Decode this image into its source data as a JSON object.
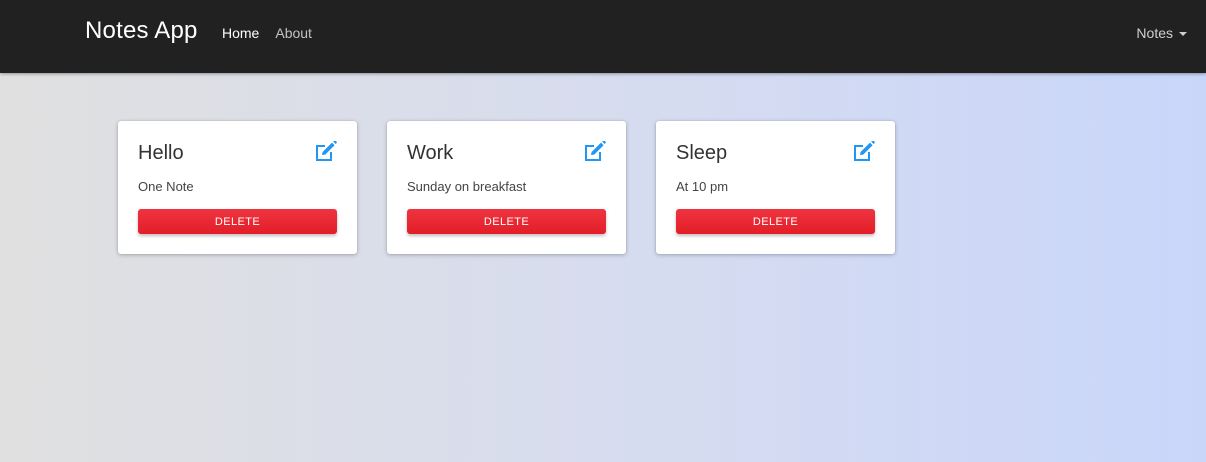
{
  "navbar": {
    "brand": "Notes App",
    "links": [
      {
        "label": "Home",
        "active": true
      },
      {
        "label": "About",
        "active": false
      }
    ],
    "dropdown_label": "Notes"
  },
  "notes": [
    {
      "title": "Hello",
      "text": "One Note",
      "delete_label": "DELETE",
      "edit_icon": "edit-icon"
    },
    {
      "title": "Work",
      "text": "Sunday on breakfast",
      "delete_label": "DELETE",
      "edit_icon": "edit-icon"
    },
    {
      "title": "Sleep",
      "text": "At 10 pm",
      "delete_label": "DELETE",
      "edit_icon": "edit-icon"
    }
  ],
  "colors": {
    "navbar_bg": "#212121",
    "accent_blue": "#2196f3",
    "delete_red": "#e8262f"
  }
}
